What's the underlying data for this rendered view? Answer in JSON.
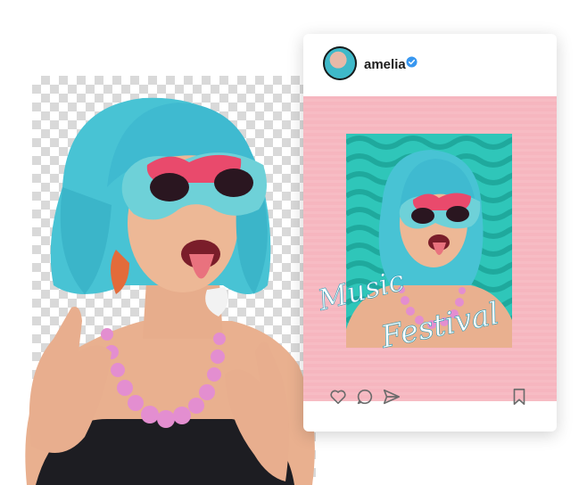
{
  "post": {
    "username": "amelia",
    "verified": true,
    "overlay_text_line1": "Music",
    "overlay_text_line2": "Festival"
  },
  "actions": {
    "like_icon": "heart-icon",
    "comment_icon": "comment-icon",
    "share_icon": "send-icon",
    "save_icon": "bookmark-icon"
  },
  "colors": {
    "wig": "#49c6d6",
    "sunglasses": "#e84a6c",
    "post_background": "#f6b6bf",
    "frame": "#2fc6b9",
    "verified_badge": "#3897f0"
  }
}
